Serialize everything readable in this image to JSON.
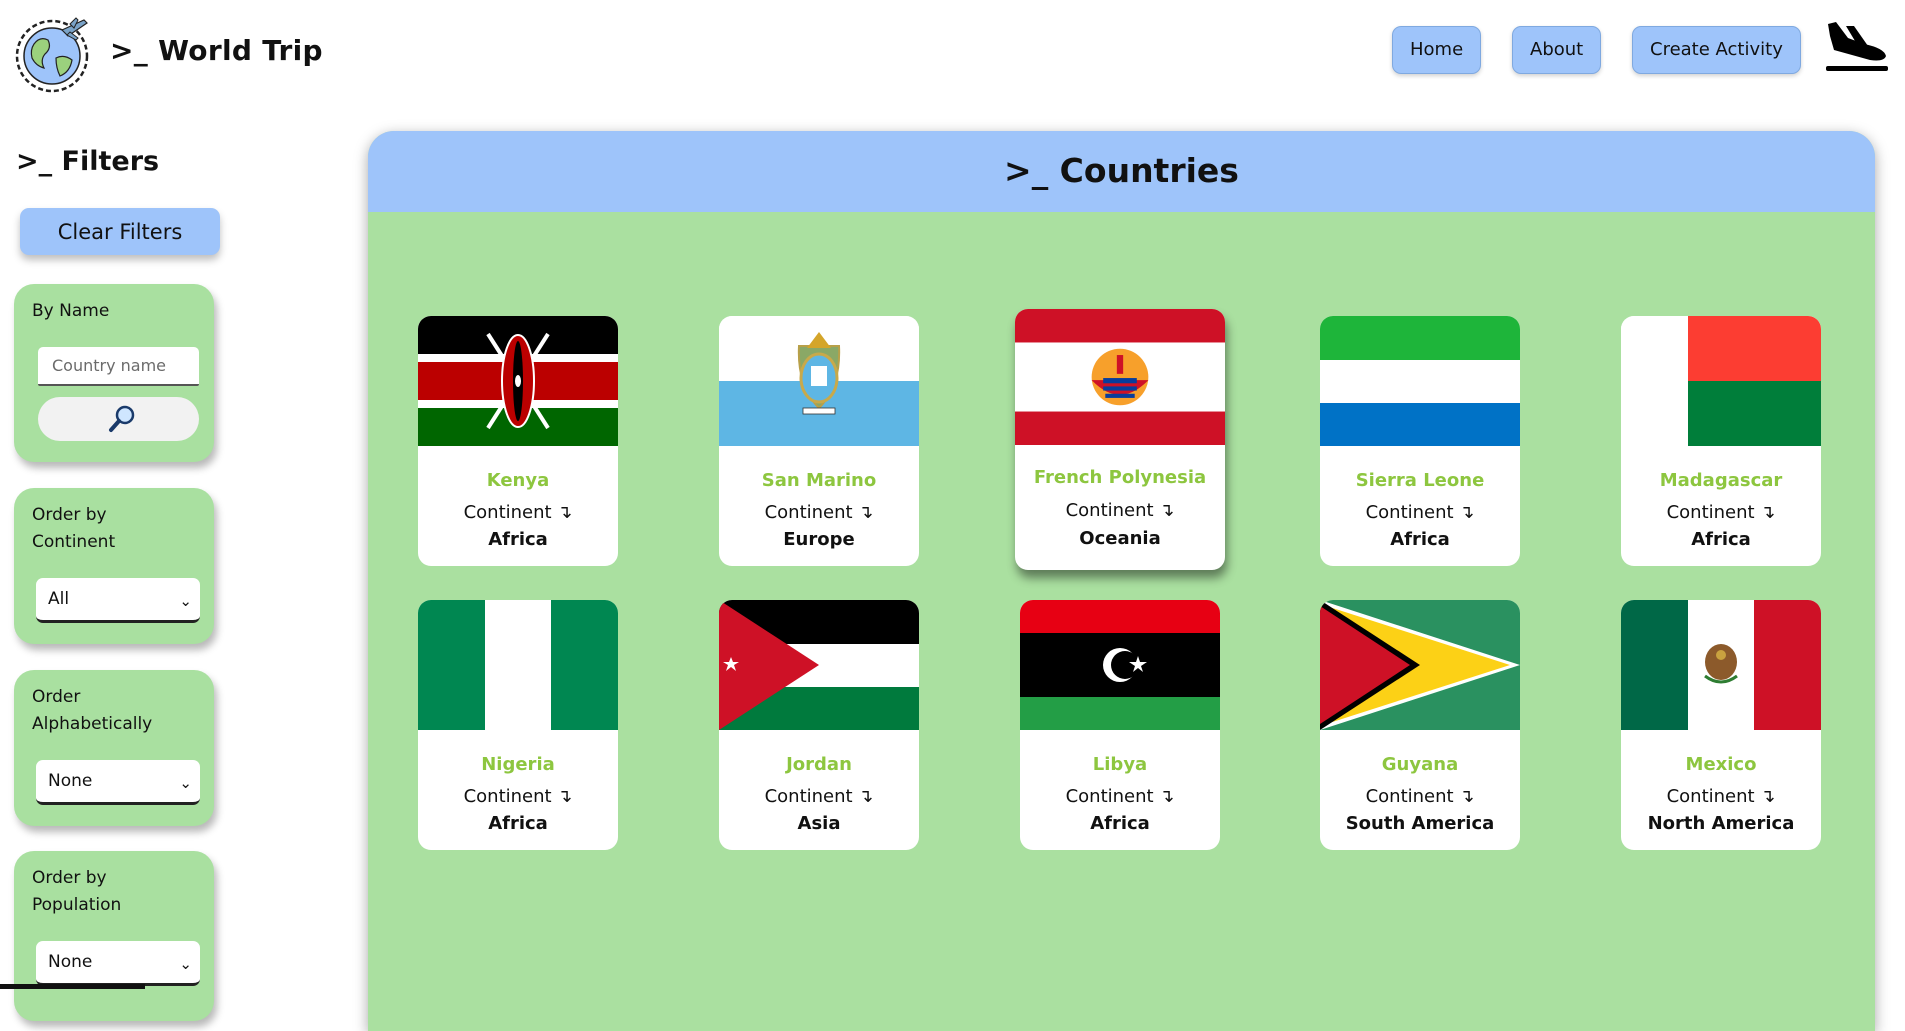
{
  "header": {
    "brand": ">_ World Trip",
    "nav": {
      "home": "Home",
      "about": "About",
      "create": "Create Activity"
    }
  },
  "sidebar": {
    "title": ">_ Filters",
    "clear": "Clear Filters",
    "by_name": {
      "label": "By Name",
      "placeholder": "Country name"
    },
    "continent": {
      "label": "Order by Continent",
      "value": "All"
    },
    "alphabetical": {
      "label": "Order Alphabetically",
      "value": "None"
    },
    "population": {
      "label": "Order by Population",
      "value": "None"
    }
  },
  "main": {
    "title": ">_ Countries",
    "continent_label": "Continent ↴",
    "countries": [
      {
        "name": "Kenya",
        "continent": "Africa",
        "flag": "kenya"
      },
      {
        "name": "San Marino",
        "continent": "Europe",
        "flag": "san-marino"
      },
      {
        "name": "French Polynesia",
        "continent": "Oceania",
        "flag": "french-polynesia"
      },
      {
        "name": "Sierra Leone",
        "continent": "Africa",
        "flag": "sierra-leone"
      },
      {
        "name": "Madagascar",
        "continent": "Africa",
        "flag": "madagascar"
      },
      {
        "name": "Nigeria",
        "continent": "Africa",
        "flag": "nigeria"
      },
      {
        "name": "Jordan",
        "continent": "Asia",
        "flag": "jordan"
      },
      {
        "name": "Libya",
        "continent": "Africa",
        "flag": "libya"
      },
      {
        "name": "Guyana",
        "continent": "South America",
        "flag": "guyana"
      },
      {
        "name": "Mexico",
        "continent": "North America",
        "flag": "mexico"
      }
    ]
  },
  "colors": {
    "accent_blue": "#9ec4fa",
    "panel_green": "#aae0a0",
    "country_name_green": "#8dc63f"
  }
}
